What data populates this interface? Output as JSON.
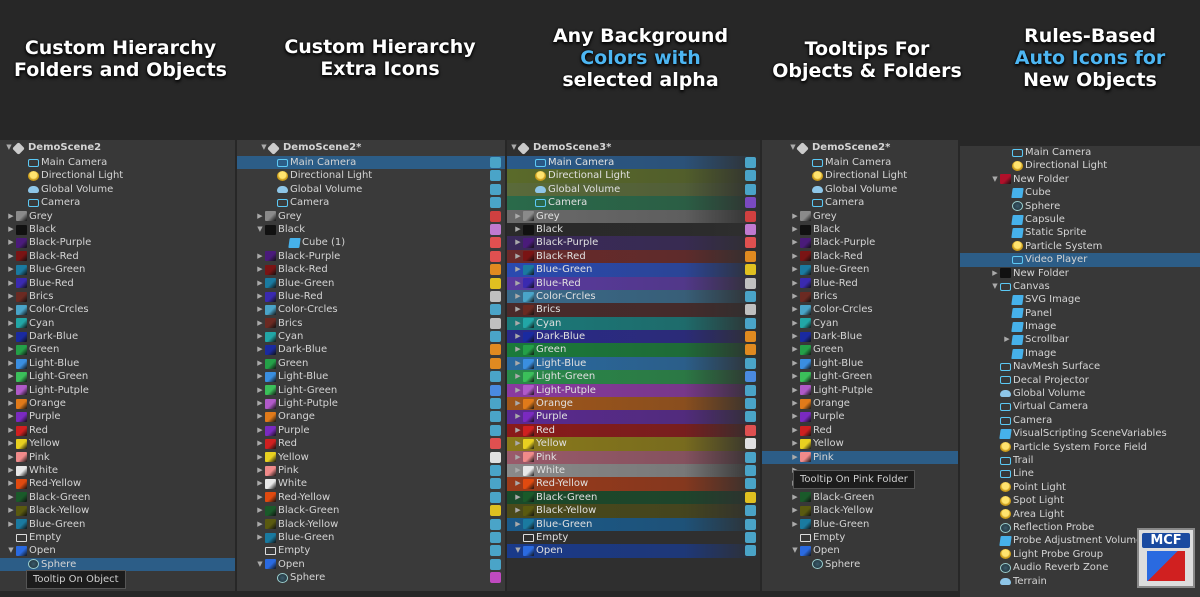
{
  "headings": [
    {
      "lines": [
        {
          "t": "Custom Hierarchy",
          "blue": false
        },
        {
          "t": "Folders and Objects",
          "blue": false
        }
      ]
    },
    {
      "lines": [
        {
          "t": "Custom Hierarchy",
          "blue": false
        },
        {
          "t": "Extra Icons",
          "blue": false
        }
      ]
    },
    {
      "lines": [
        {
          "t": "Any Background",
          "blue": false
        },
        {
          "t": "Colors with",
          "blue": true
        },
        {
          "t": "selected alpha",
          "blue": false
        }
      ]
    },
    {
      "lines": [
        {
          "t": "Tooltips For",
          "blue": false
        },
        {
          "t": "Objects & Folders",
          "blue": false
        }
      ]
    },
    {
      "lines": [
        {
          "t": "Rules-Based",
          "blue": false
        },
        {
          "t": "Auto Icons for",
          "blue": true
        },
        {
          "t": "New Objects",
          "blue": false
        }
      ]
    }
  ],
  "colors": {
    "Grey": "#8a8a8a",
    "Black": "#111111",
    "Black-Purple": "#4a1b7a",
    "Black-Red": "#7a1414",
    "Blue-Green": "#1a7aa0",
    "Blue-Red": "#3a2ab0",
    "Brics": "#6b2a22",
    "Color-Crcles": "#4aa4c8",
    "Cyan": "#22a6a6",
    "Dark-Blue": "#1a2aa0",
    "Green": "#24a048",
    "Light-Blue": "#3a8ee0",
    "Light-Green": "#3bbf5a",
    "Light-Putple": "#b05ac8",
    "Orange": "#e07a1a",
    "Purple": "#7a2ac0",
    "Red": "#d02020",
    "Yellow": "#e8d020",
    "Pink": "#f08a8a",
    "White": "#e8e8e8",
    "Red-Yellow": "#e04a10",
    "Black-Green": "#1a5a2a",
    "Black-Yellow": "#5a5a10",
    "Open": "#2a6ae0",
    "New Folder": "#b0102a"
  },
  "panel1": {
    "title": "DemoScene2",
    "tooltip": "Tooltip On Object",
    "rows": [
      {
        "d": 1,
        "t": "Main Camera",
        "i": "cam"
      },
      {
        "d": 1,
        "t": "Directional Light",
        "i": "bulb"
      },
      {
        "d": 1,
        "t": "Global Volume",
        "i": "cloud"
      },
      {
        "d": 1,
        "t": "Camera",
        "i": "cam"
      },
      {
        "d": 0,
        "a": "r",
        "t": "Grey",
        "f": "Grey"
      },
      {
        "d": 0,
        "a": "r",
        "t": "Black",
        "f": "Black"
      },
      {
        "d": 0,
        "a": "r",
        "t": "Black-Purple",
        "f": "Black-Purple"
      },
      {
        "d": 0,
        "a": "r",
        "t": "Black-Red",
        "f": "Black-Red"
      },
      {
        "d": 0,
        "a": "r",
        "t": "Blue-Green",
        "f": "Blue-Green"
      },
      {
        "d": 0,
        "a": "r",
        "t": "Blue-Red",
        "f": "Blue-Red"
      },
      {
        "d": 0,
        "a": "r",
        "t": "Brics",
        "f": "Brics"
      },
      {
        "d": 0,
        "a": "r",
        "t": "Color-Crcles",
        "f": "Color-Crcles"
      },
      {
        "d": 0,
        "a": "r",
        "t": "Cyan",
        "f": "Cyan"
      },
      {
        "d": 0,
        "a": "r",
        "t": "Dark-Blue",
        "f": "Dark-Blue"
      },
      {
        "d": 0,
        "a": "r",
        "t": "Green",
        "f": "Green"
      },
      {
        "d": 0,
        "a": "r",
        "t": "Light-Blue",
        "f": "Light-Blue"
      },
      {
        "d": 0,
        "a": "r",
        "t": "Light-Green",
        "f": "Light-Green"
      },
      {
        "d": 0,
        "a": "r",
        "t": "Light-Putple",
        "f": "Light-Putple"
      },
      {
        "d": 0,
        "a": "r",
        "t": "Orange",
        "f": "Orange"
      },
      {
        "d": 0,
        "a": "r",
        "t": "Purple",
        "f": "Purple"
      },
      {
        "d": 0,
        "a": "r",
        "t": "Red",
        "f": "Red"
      },
      {
        "d": 0,
        "a": "r",
        "t": "Yellow",
        "f": "Yellow"
      },
      {
        "d": 0,
        "a": "r",
        "t": "Pink",
        "f": "Pink"
      },
      {
        "d": 0,
        "a": "r",
        "t": "White",
        "f": "White"
      },
      {
        "d": 0,
        "a": "r",
        "t": "Red-Yellow",
        "f": "Red-Yellow"
      },
      {
        "d": 0,
        "a": "r",
        "t": "Black-Green",
        "f": "Black-Green"
      },
      {
        "d": 0,
        "a": "r",
        "t": "Black-Yellow",
        "f": "Black-Yellow"
      },
      {
        "d": 0,
        "a": "r",
        "t": "Blue-Green",
        "f": "Blue-Green"
      },
      {
        "d": 0,
        "t": "Empty",
        "i": "empty"
      },
      {
        "d": 0,
        "a": "d",
        "t": "Open",
        "f": "Open"
      },
      {
        "d": 1,
        "t": "Sphere",
        "i": "sphere",
        "sel": true
      }
    ]
  },
  "panel2": {
    "title": "DemoScene2*",
    "rows": [
      {
        "d": 1,
        "t": "Main Camera",
        "i": "cam",
        "sel": true,
        "x": "#4aa4c8"
      },
      {
        "d": 1,
        "t": "Directional Light",
        "i": "bulb",
        "x": "#4aa4c8"
      },
      {
        "d": 1,
        "t": "Global Volume",
        "i": "cloud",
        "x": "#4aa4c8"
      },
      {
        "d": 1,
        "t": "Camera",
        "i": "cam",
        "x": "#4aa4c8"
      },
      {
        "d": 0,
        "a": "r",
        "t": "Grey",
        "f": "Grey",
        "x": "#d04040"
      },
      {
        "d": 0,
        "a": "d",
        "t": "Black",
        "f": "Black",
        "x": "#c07ad0"
      },
      {
        "d": 2,
        "t": "Cube (1)",
        "i": "cube",
        "x": "#e05050"
      },
      {
        "d": 0,
        "a": "r",
        "t": "Black-Purple",
        "f": "Black-Purple",
        "x": "#e05050"
      },
      {
        "d": 0,
        "a": "r",
        "t": "Black-Red",
        "f": "Black-Red",
        "x": "#e08a20"
      },
      {
        "d": 0,
        "a": "r",
        "t": "Blue-Green",
        "f": "Blue-Green",
        "x": "#e0c020"
      },
      {
        "d": 0,
        "a": "r",
        "t": "Blue-Red",
        "f": "Blue-Red",
        "x": "#c0c0c0"
      },
      {
        "d": 0,
        "a": "r",
        "t": "Color-Crcles",
        "f": "Color-Crcles",
        "x": "#4aa4c8"
      },
      {
        "d": 0,
        "a": "r",
        "t": "Brics",
        "f": "Brics",
        "x": "#c0c0c0"
      },
      {
        "d": 0,
        "a": "r",
        "t": "Cyan",
        "f": "Cyan",
        "x": "#4aa4c8"
      },
      {
        "d": 0,
        "a": "r",
        "t": "Dark-Blue",
        "f": "Dark-Blue",
        "x": "#e08a20"
      },
      {
        "d": 0,
        "a": "r",
        "t": "Green",
        "f": "Green",
        "x": "#e08a20"
      },
      {
        "d": 0,
        "a": "r",
        "t": "Light-Blue",
        "f": "Light-Blue",
        "x": "#4aa4c8"
      },
      {
        "d": 0,
        "a": "r",
        "t": "Light-Green",
        "f": "Light-Green",
        "x": "#4a8ae0"
      },
      {
        "d": 0,
        "a": "r",
        "t": "Light-Putple",
        "f": "Light-Putple",
        "x": "#4aa4c8"
      },
      {
        "d": 0,
        "a": "r",
        "t": "Orange",
        "f": "Orange",
        "x": "#4aa4c8"
      },
      {
        "d": 0,
        "a": "r",
        "t": "Purple",
        "f": "Purple",
        "x": "#4aa4c8"
      },
      {
        "d": 0,
        "a": "r",
        "t": "Red",
        "f": "Red",
        "x": "#e05050"
      },
      {
        "d": 0,
        "a": "r",
        "t": "Yellow",
        "f": "Yellow",
        "x": "#e0e0e0"
      },
      {
        "d": 0,
        "a": "r",
        "t": "Pink",
        "f": "Pink",
        "x": "#4aa4c8"
      },
      {
        "d": 0,
        "a": "r",
        "t": "White",
        "f": "White",
        "x": "#4aa4c8"
      },
      {
        "d": 0,
        "a": "r",
        "t": "Red-Yellow",
        "f": "Red-Yellow",
        "x": "#4aa4c8"
      },
      {
        "d": 0,
        "a": "r",
        "t": "Black-Green",
        "f": "Black-Green",
        "x": "#e0c020"
      },
      {
        "d": 0,
        "a": "r",
        "t": "Black-Yellow",
        "f": "Black-Yellow",
        "x": "#4aa4c8"
      },
      {
        "d": 0,
        "a": "r",
        "t": "Blue-Green",
        "f": "Blue-Green",
        "x": "#4aa4c8"
      },
      {
        "d": 0,
        "t": "Empty",
        "i": "empty",
        "x": "#4aa4c8"
      },
      {
        "d": 0,
        "a": "d",
        "t": "Open",
        "f": "Open",
        "x": "#4aa4c8"
      },
      {
        "d": 1,
        "t": "Sphere",
        "i": "sphere",
        "x": "#c04ac0"
      }
    ]
  },
  "panel3": {
    "title": "DemoScene3*",
    "rows": [
      {
        "d": 1,
        "t": "Main Camera",
        "i": "cam",
        "bg": "#2a5a8a",
        "x": "#4aa4c8"
      },
      {
        "d": 1,
        "t": "Directional Light",
        "i": "bulb",
        "bg": "#5a6a2a",
        "x": "#4aa4c8"
      },
      {
        "d": 1,
        "t": "Global Volume",
        "i": "cloud",
        "bg": "#5a6a3a",
        "x": "#4aa4c8"
      },
      {
        "d": 1,
        "t": "Camera",
        "i": "cam",
        "bg": "#2a6a4a",
        "x": "#7a4ac0"
      },
      {
        "d": 0,
        "a": "r",
        "t": "Grey",
        "f": "Grey",
        "bg": "#6a6a6a",
        "x": "#d04040"
      },
      {
        "d": 0,
        "a": "r",
        "t": "Black",
        "f": "Black",
        "bg": "#2a2a2a",
        "x": "#c07ad0"
      },
      {
        "d": 0,
        "a": "r",
        "t": "Black-Purple",
        "f": "Black-Purple",
        "bg": "#3a2a5a",
        "x": "#e05050"
      },
      {
        "d": 0,
        "a": "r",
        "t": "Black-Red",
        "f": "Black-Red",
        "bg": "#6a2a2a",
        "x": "#e08a20"
      },
      {
        "d": 0,
        "a": "r",
        "t": "Blue-Green",
        "f": "Blue-Green",
        "bg": "#2a4ab0",
        "x": "#e0c020"
      },
      {
        "d": 0,
        "a": "r",
        "t": "Blue-Red",
        "f": "Blue-Red",
        "bg": "#5a3aa0",
        "x": "#c0c0c0"
      },
      {
        "d": 0,
        "a": "r",
        "t": "Color-Crcles",
        "f": "Color-Crcles",
        "bg": "#3a6a8a",
        "x": "#4aa4c8"
      },
      {
        "d": 0,
        "a": "r",
        "t": "Brics",
        "f": "Brics",
        "bg": "#4a2a2a",
        "x": "#c0c0c0"
      },
      {
        "d": 0,
        "a": "r",
        "t": "Cyan",
        "f": "Cyan",
        "bg": "#1a7a7a",
        "x": "#4aa4c8"
      },
      {
        "d": 0,
        "a": "r",
        "t": "Dark-Blue",
        "f": "Dark-Blue",
        "bg": "#2a2a8a",
        "x": "#e08a20"
      },
      {
        "d": 0,
        "a": "r",
        "t": "Green",
        "f": "Green",
        "bg": "#1a7a3a",
        "x": "#e08a20"
      },
      {
        "d": 0,
        "a": "r",
        "t": "Light-Blue",
        "f": "Light-Blue",
        "bg": "#2a6aa0",
        "x": "#4aa4c8"
      },
      {
        "d": 0,
        "a": "r",
        "t": "Light-Green",
        "f": "Light-Green",
        "bg": "#2a8a4a",
        "x": "#4a8ae0"
      },
      {
        "d": 0,
        "a": "r",
        "t": "Light-Putple",
        "f": "Light-Putple",
        "bg": "#8a3aa0",
        "x": "#4aa4c8"
      },
      {
        "d": 0,
        "a": "r",
        "t": "Orange",
        "f": "Orange",
        "bg": "#a0561a",
        "x": "#4aa4c8"
      },
      {
        "d": 0,
        "a": "r",
        "t": "Purple",
        "f": "Purple",
        "bg": "#5a2a90",
        "x": "#4aa4c8"
      },
      {
        "d": 0,
        "a": "r",
        "t": "Red",
        "f": "Red",
        "bg": "#8a1a1a",
        "x": "#e05050"
      },
      {
        "d": 0,
        "a": "r",
        "t": "Yellow",
        "f": "Yellow",
        "bg": "#8a7a1a",
        "x": "#e0e0e0"
      },
      {
        "d": 0,
        "a": "r",
        "t": "Pink",
        "f": "Pink",
        "bg": "#9a5a6a",
        "x": "#4aa4c8"
      },
      {
        "d": 0,
        "a": "r",
        "t": "White",
        "f": "White",
        "bg": "#8a8a8a",
        "x": "#4aa4c8"
      },
      {
        "d": 0,
        "a": "r",
        "t": "Red-Yellow",
        "f": "Red-Yellow",
        "bg": "#9a3a1a",
        "x": "#4aa4c8"
      },
      {
        "d": 0,
        "a": "r",
        "t": "Black-Green",
        "f": "Black-Green",
        "bg": "#1a4a2a",
        "x": "#e0c020"
      },
      {
        "d": 0,
        "a": "r",
        "t": "Black-Yellow",
        "f": "Black-Yellow",
        "bg": "#4a4a1a",
        "x": "#4aa4c8"
      },
      {
        "d": 0,
        "a": "r",
        "t": "Blue-Green",
        "f": "Blue-Green",
        "bg": "#1a5a8a",
        "x": "#4aa4c8"
      },
      {
        "d": 0,
        "t": "Empty",
        "i": "empty",
        "x": "#4aa4c8"
      },
      {
        "d": 0,
        "a": "d",
        "t": "Open",
        "f": "Open",
        "bg": "#1a3a8a",
        "x": "#4aa4c8"
      }
    ]
  },
  "panel4": {
    "title": "DemoScene2*",
    "tooltip": "Tooltip On Pink Folder",
    "rows": [
      {
        "d": 1,
        "t": "Main Camera",
        "i": "cam"
      },
      {
        "d": 1,
        "t": "Directional Light",
        "i": "bulb"
      },
      {
        "d": 1,
        "t": "Global Volume",
        "i": "cloud"
      },
      {
        "d": 1,
        "t": "Camera",
        "i": "cam"
      },
      {
        "d": 0,
        "a": "r",
        "t": "Grey",
        "f": "Grey"
      },
      {
        "d": 0,
        "a": "r",
        "t": "Black",
        "f": "Black"
      },
      {
        "d": 0,
        "a": "r",
        "t": "Black-Purple",
        "f": "Black-Purple"
      },
      {
        "d": 0,
        "a": "r",
        "t": "Black-Red",
        "f": "Black-Red"
      },
      {
        "d": 0,
        "a": "r",
        "t": "Blue-Green",
        "f": "Blue-Green"
      },
      {
        "d": 0,
        "a": "r",
        "t": "Blue-Red",
        "f": "Blue-Red"
      },
      {
        "d": 0,
        "a": "r",
        "t": "Brics",
        "f": "Brics"
      },
      {
        "d": 0,
        "a": "r",
        "t": "Color-Crcles",
        "f": "Color-Crcles"
      },
      {
        "d": 0,
        "a": "r",
        "t": "Cyan",
        "f": "Cyan"
      },
      {
        "d": 0,
        "a": "r",
        "t": "Dark-Blue",
        "f": "Dark-Blue"
      },
      {
        "d": 0,
        "a": "r",
        "t": "Green",
        "f": "Green"
      },
      {
        "d": 0,
        "a": "r",
        "t": "Light-Blue",
        "f": "Light-Blue"
      },
      {
        "d": 0,
        "a": "r",
        "t": "Light-Green",
        "f": "Light-Green"
      },
      {
        "d": 0,
        "a": "r",
        "t": "Light-Putple",
        "f": "Light-Putple"
      },
      {
        "d": 0,
        "a": "r",
        "t": "Orange",
        "f": "Orange"
      },
      {
        "d": 0,
        "a": "r",
        "t": "Purple",
        "f": "Purple"
      },
      {
        "d": 0,
        "a": "r",
        "t": "Red",
        "f": "Red"
      },
      {
        "d": 0,
        "a": "r",
        "t": "Yellow",
        "f": "Yellow"
      },
      {
        "d": 0,
        "a": "r",
        "t": "Pink",
        "f": "Pink",
        "sel": true
      },
      {
        "d": 0,
        "a": "r",
        "t": "",
        "f": ""
      },
      {
        "d": 0,
        "a": "r",
        "t": "",
        "f": ""
      },
      {
        "d": 0,
        "a": "r",
        "t": "Black-Green",
        "f": "Black-Green"
      },
      {
        "d": 0,
        "a": "r",
        "t": "Black-Yellow",
        "f": "Black-Yellow"
      },
      {
        "d": 0,
        "a": "r",
        "t": "Blue-Green",
        "f": "Blue-Green"
      },
      {
        "d": 0,
        "t": "Empty",
        "i": "empty"
      },
      {
        "d": 0,
        "a": "d",
        "t": "Open",
        "f": "Open"
      },
      {
        "d": 1,
        "t": "Sphere",
        "i": "sphere"
      }
    ]
  },
  "panel5": {
    "rows": [
      {
        "d": 1,
        "t": "Main Camera",
        "i": "cam"
      },
      {
        "d": 1,
        "t": "Directional Light",
        "i": "bulb"
      },
      {
        "d": 0,
        "a": "d",
        "t": "New Folder",
        "f": "New Folder"
      },
      {
        "d": 1,
        "t": "Cube",
        "i": "cube"
      },
      {
        "d": 1,
        "t": "Sphere",
        "i": "sphere"
      },
      {
        "d": 1,
        "t": "Capsule",
        "i": "cube"
      },
      {
        "d": 1,
        "t": "Static Sprite",
        "i": "cube"
      },
      {
        "d": 1,
        "t": "Particle System",
        "i": "bulb"
      },
      {
        "d": 1,
        "t": "Video Player",
        "i": "cam",
        "sel": true
      },
      {
        "d": 0,
        "a": "r",
        "t": "New Folder",
        "f": "Black"
      },
      {
        "d": 0,
        "a": "d",
        "t": "Canvas",
        "i": "cam"
      },
      {
        "d": 1,
        "t": "SVG Image",
        "i": "cube"
      },
      {
        "d": 1,
        "t": "Panel",
        "i": "cube"
      },
      {
        "d": 1,
        "t": "Image",
        "i": "cube"
      },
      {
        "d": 1,
        "a": "r",
        "t": "Scrollbar",
        "i": "cube"
      },
      {
        "d": 1,
        "t": "Image",
        "i": "cube"
      },
      {
        "d": 0,
        "t": "NavMesh Surface",
        "i": "cam"
      },
      {
        "d": 0,
        "t": "Decal Projector",
        "i": "cam"
      },
      {
        "d": 0,
        "t": "Global Volume",
        "i": "cloud"
      },
      {
        "d": 0,
        "t": "Virtual Camera",
        "i": "cam"
      },
      {
        "d": 0,
        "t": "Camera",
        "i": "cam"
      },
      {
        "d": 0,
        "t": "VisualScripting SceneVariables",
        "i": "cube"
      },
      {
        "d": 0,
        "t": "Particle System Force Field",
        "i": "bulb"
      },
      {
        "d": 0,
        "t": "Trail",
        "i": "cam"
      },
      {
        "d": 0,
        "t": "Line",
        "i": "cam"
      },
      {
        "d": 0,
        "t": "Point Light",
        "i": "bulb"
      },
      {
        "d": 0,
        "t": "Spot Light",
        "i": "bulb"
      },
      {
        "d": 0,
        "t": "Area Light",
        "i": "bulb"
      },
      {
        "d": 0,
        "t": "Reflection Probe",
        "i": "sphere"
      },
      {
        "d": 0,
        "t": "Probe Adjustment Volume",
        "i": "cube"
      },
      {
        "d": 0,
        "t": "Light Probe Group",
        "i": "bulb"
      },
      {
        "d": 0,
        "t": "Audio Reverb Zone",
        "i": "sphere"
      },
      {
        "d": 0,
        "t": "Terrain",
        "i": "cloud"
      }
    ]
  },
  "logo": {
    "text": "MCF"
  }
}
